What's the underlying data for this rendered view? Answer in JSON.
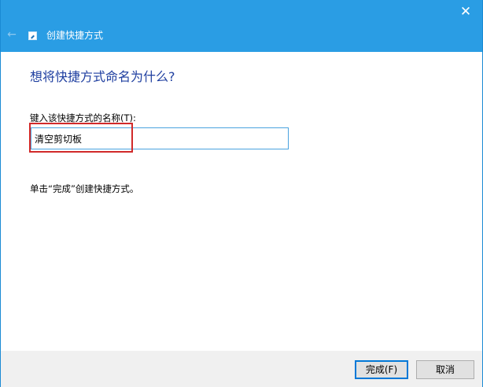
{
  "titlebar": {
    "close_glyph": "✕",
    "back_glyph": "←",
    "wizard_title": "创建快捷方式"
  },
  "main": {
    "question": "想将快捷方式命名为什么?",
    "input_label": "键入该快捷方式的名称(T):",
    "input_value": "清空剪切板",
    "hint": "单击“完成”创建快捷方式。"
  },
  "footer": {
    "finish_label": "完成(F)",
    "cancel_label": "取消"
  },
  "colors": {
    "titlebar": "#2a9de4",
    "heading": "#1f3fa0",
    "highlight": "#d12a2a"
  }
}
